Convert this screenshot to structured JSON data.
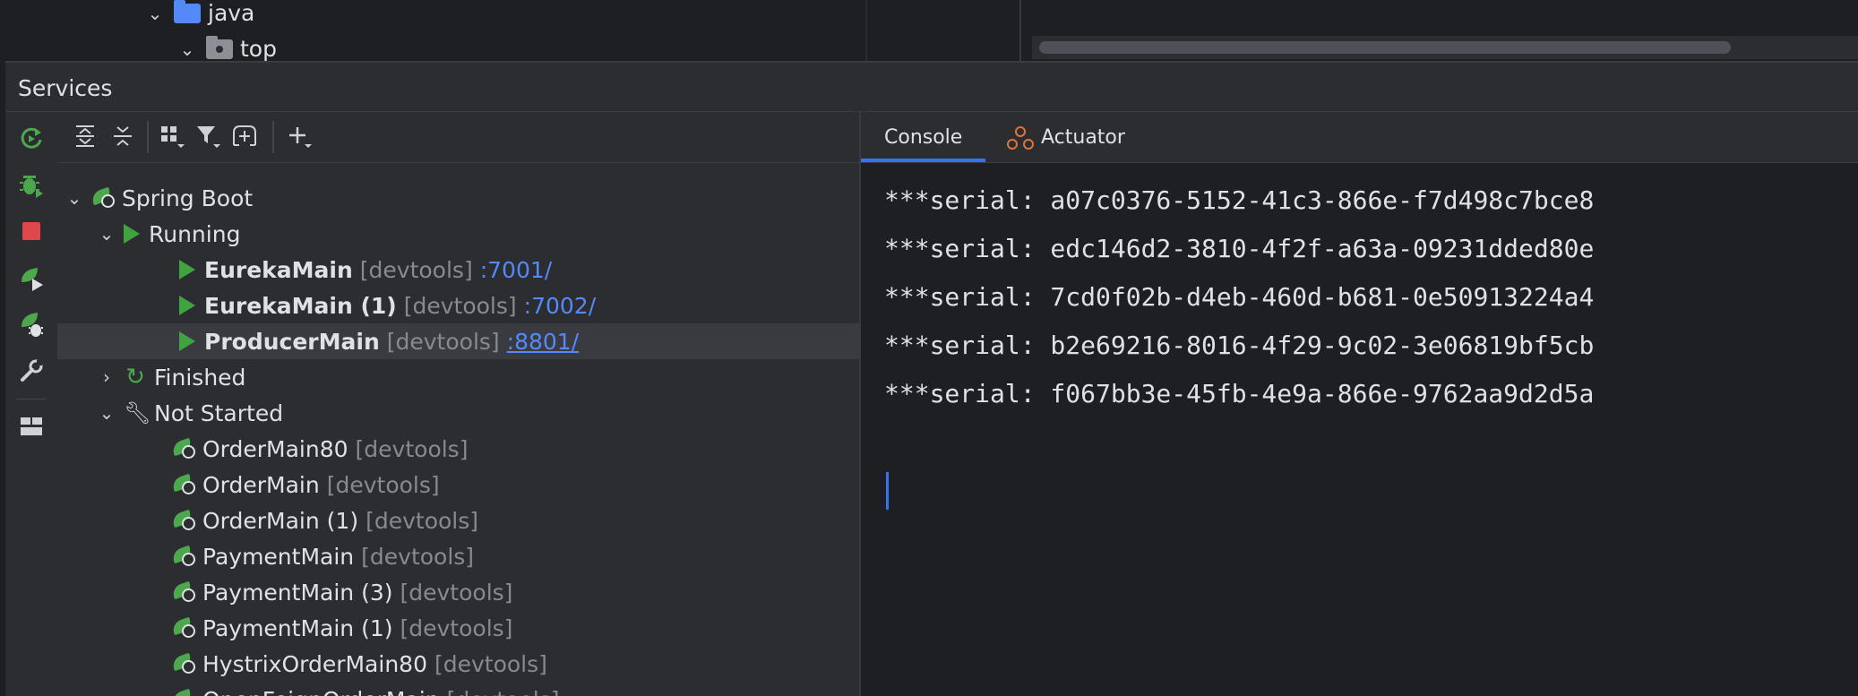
{
  "project_tree": {
    "folders": [
      {
        "label": "java"
      },
      {
        "label": "top"
      }
    ]
  },
  "services": {
    "title": "Services",
    "toolbar": {
      "expand_all": "expand-all-icon",
      "collapse_all": "collapse-all-icon",
      "group_by": "group-by-icon",
      "filter": "filter-icon",
      "new_tab": "new-tab-icon",
      "add": "add-icon"
    },
    "tree": {
      "spring_boot": "Spring Boot",
      "running": "Running",
      "running_items": [
        {
          "name": "EurekaMain",
          "tag": "[devtools]",
          "port": ":7001/"
        },
        {
          "name": "EurekaMain (1)",
          "tag": "[devtools]",
          "port": ":7002/"
        },
        {
          "name": "ProducerMain",
          "tag": "[devtools]",
          "port": ":8801/"
        }
      ],
      "finished": "Finished",
      "not_started": "Not Started",
      "not_started_items": [
        {
          "name": "OrderMain80",
          "tag": "[devtools]"
        },
        {
          "name": "OrderMain",
          "tag": "[devtools]"
        },
        {
          "name": "OrderMain (1)",
          "tag": "[devtools]"
        },
        {
          "name": "PaymentMain",
          "tag": "[devtools]"
        },
        {
          "name": "PaymentMain (3)",
          "tag": "[devtools]"
        },
        {
          "name": "PaymentMain (1)",
          "tag": "[devtools]"
        },
        {
          "name": "HystrixOrderMain80",
          "tag": "[devtools]"
        },
        {
          "name": "OpenFeignOrderMain",
          "tag": "[devtools]"
        }
      ]
    },
    "tabs": {
      "console": "Console",
      "actuator": "Actuator"
    },
    "console_lines": [
      "***serial: a07c0376-5152-41c3-866e-f7d498c7bce8",
      "***serial: edc146d2-3810-4f2f-a63a-09231dded80e",
      "***serial: 7cd0f02b-d4eb-460d-b681-0e50913224a4",
      "***serial: b2e69216-8016-4f29-9c02-3e06819bf5cb",
      "***serial: f067bb3e-45fb-4e9a-866e-9762aa9d2d5a"
    ]
  },
  "colors": {
    "accent": "#3574f0",
    "run_green": "#3fa33f",
    "link_blue": "#548af7",
    "stop_red": "#e0474a",
    "actuator_orange": "#e0743a"
  }
}
